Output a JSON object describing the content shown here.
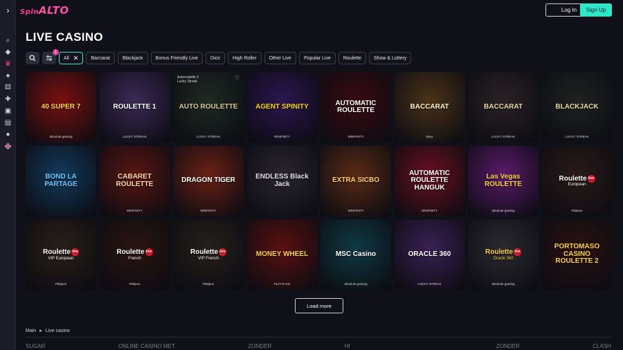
{
  "header": {
    "logo_prefix": "Spin",
    "logo_main": "ALTO",
    "login_label": "Log In",
    "signup_label": "Sign Up"
  },
  "sidebar": {
    "toggle_icon": "chevron-right-icon",
    "items": [
      "search-icon",
      "tag-icon",
      "crown-icon",
      "spade-icon",
      "dice-icon",
      "puzzle-icon",
      "slot-machine-icon",
      "cards-icon",
      "chat-icon",
      "flag-uk-icon"
    ]
  },
  "page": {
    "title": "LIVE CASINO"
  },
  "filters": {
    "badge_count": "1",
    "active": "All",
    "chips": [
      "Baccarat",
      "Blackjack",
      "Bonus Friendly Live",
      "Dice",
      "High Roller",
      "Other Live",
      "Popular Live",
      "Roulette",
      "Show & Lottery"
    ]
  },
  "games": [
    {
      "name": "40 SUPER 7",
      "sub": "absolute gaming",
      "bg": "#7a1010",
      "fg": "#ffd23f"
    },
    {
      "name": "ROULETTE 1",
      "sub": "LUCKY STREAK",
      "bg": "#3a2a55",
      "fg": "#fff"
    },
    {
      "name": "AUTO ROULETTE",
      "top": "Autoroulette 2",
      "top2": "Lucky Streak",
      "sub": "LUCKY STREAK",
      "bg": "#1e2a22",
      "fg": "#d8c79a",
      "heart": "♡"
    },
    {
      "name": "AGENT SPINITY",
      "sub": "WINFINITY",
      "bg": "#2a1650",
      "fg": "#ffd400"
    },
    {
      "name": "AUTOMATIC ROULETTE",
      "sub": "WINFINITY",
      "bg": "#3a0a12",
      "fg": "#fff"
    },
    {
      "name": "BACCARAT",
      "sub": "Sexy",
      "bg": "#4a3218",
      "fg": "#fff3c9"
    },
    {
      "name": "BACCARAT",
      "sub": "LUCKY STREAK",
      "bg": "#2a2225",
      "fg": "#e9d9a5"
    },
    {
      "name": "BLACKJACK",
      "sub": "LUCKY STREAK",
      "bg": "#1f2220",
      "fg": "#e9d9a5"
    },
    {
      "name": "BOND LA PARTAGE",
      "sub": "",
      "bg": "#123a5c",
      "fg": "#6ec8ff"
    },
    {
      "name": "CABARET ROULETTE",
      "sub": "WINFINITY",
      "bg": "#5a1512",
      "fg": "#ffd9a8"
    },
    {
      "name": "DRAGON TIGER",
      "sub": "WINFINITY",
      "bg": "#6a2015",
      "fg": "#fff"
    },
    {
      "name": "ENDLESS Black Jack",
      "sub": "",
      "bg": "#2a2530",
      "fg": "#e0e0e8"
    },
    {
      "name": "EXTRA SICBO",
      "sub": "WINFINITY",
      "bg": "#5a2a15",
      "fg": "#ffcf70"
    },
    {
      "name": "AUTOMATIC ROULETTE HANGUK",
      "sub": "WINFINITY",
      "bg": "#6a0f20",
      "fg": "#fff"
    },
    {
      "name": "Las Vegas ROULETTE",
      "sub": "absolute gaming",
      "bg": "#5a1a6a",
      "fg": "#ffd23f"
    },
    {
      "name": "Roulette",
      "line2": "European",
      "live": "live",
      "sub": "Platipus",
      "bg": "#2a1a18",
      "fg": "#fff"
    },
    {
      "name": "Roulette",
      "line2": "VIP European",
      "live": "live",
      "sub": "Platipus",
      "bg": "#2a1f18",
      "fg": "#fff"
    },
    {
      "name": "Roulette",
      "line2": "French",
      "live": "live",
      "sub": "Platipus",
      "bg": "#2a1510",
      "fg": "#fff"
    },
    {
      "name": "Roulette",
      "line2": "VIP French",
      "live": "live",
      "sub": "Platipus",
      "bg": "#25201a",
      "fg": "#fff"
    },
    {
      "name": "MONEY WHEEL",
      "sub": "PLAY'N GO",
      "bg": "#5a1010",
      "fg": "#ffd23f"
    },
    {
      "name": "MSC Casino",
      "sub": "absolute gaming",
      "bg": "#0f3a44",
      "fg": "#fff"
    },
    {
      "name": "ORACLE 360",
      "sub": "LUCKY STREAK",
      "bg": "#3a2055",
      "fg": "#fff"
    },
    {
      "name": "Roulette",
      "line2": "Oracle 360",
      "live": "live",
      "sub": "absolute gaming",
      "bg": "#2a2a30",
      "fg": "#ffd23f"
    },
    {
      "name": "PORTOMASO CASINO ROULETTE 2",
      "sub": "",
      "bg": "#2a1212",
      "fg": "#ffd23f"
    }
  ],
  "load_more": "Load more",
  "breadcrumb": {
    "home": "Main",
    "separator": "▸",
    "current": "Live casino"
  },
  "footer_logos": [
    "SUGAR",
    "ONLINE CASINO MET",
    "ZONDER",
    "HI",
    "",
    "ZONDER",
    "CLASH"
  ]
}
